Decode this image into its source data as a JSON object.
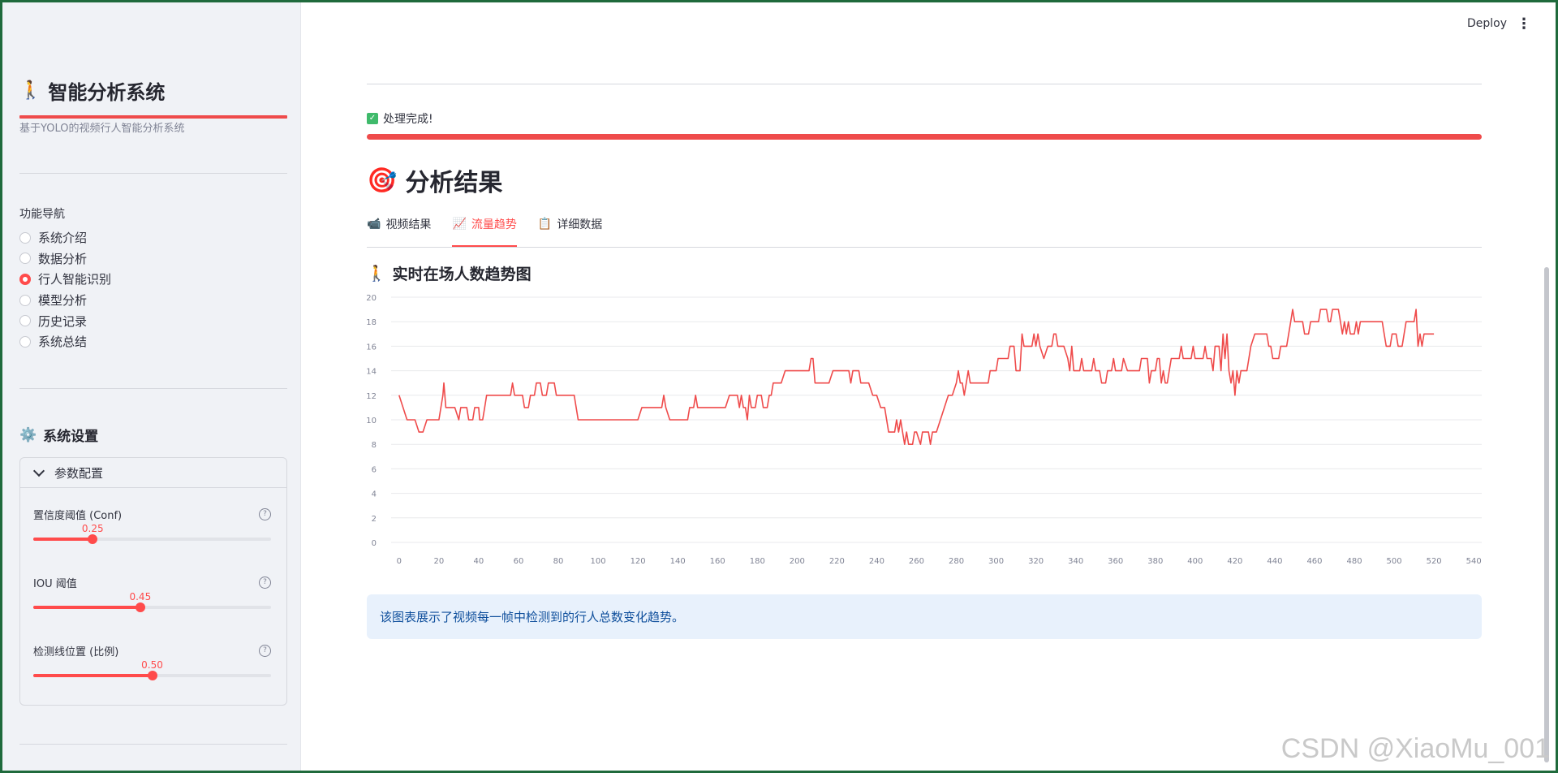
{
  "sidebar": {
    "title_emoji": "🚶",
    "title": "智能分析系统",
    "subtitle": "基于YOLO的视频行人智能分析系统",
    "nav_label": "功能导航",
    "nav_items": [
      "系统介绍",
      "数据分析",
      "行人智能识别",
      "模型分析",
      "历史记录",
      "系统总结"
    ],
    "nav_selected": "行人智能识别",
    "settings_emoji": "⚙️",
    "settings_title": "系统设置",
    "expander_label": "参数配置",
    "sliders": [
      {
        "label": "置信度阈值 (Conf)",
        "value_text": "0.25",
        "fraction": 0.25
      },
      {
        "label": "IOU 阈值",
        "value_text": "0.45",
        "fraction": 0.45
      },
      {
        "label": "检测线位置 (比例)",
        "value_text": "0.50",
        "fraction": 0.5
      }
    ]
  },
  "header": {
    "deploy_label": "Deploy",
    "menu_icon": "⋮"
  },
  "main": {
    "status_text": "处理完成!",
    "progress": 1.0,
    "section_emoji": "🎯",
    "section_title": "分析结果",
    "tabs": [
      {
        "icon": "📹",
        "label": "视频结果"
      },
      {
        "icon": "📈",
        "label": "流量趋势"
      },
      {
        "icon": "📋",
        "label": "详细数据"
      }
    ],
    "active_tab": "流量趋势",
    "chart_emoji": "🚶",
    "chart_title": "实时在场人数趋势图",
    "info_text": "该图表展示了视频每一帧中检测到的行人总数变化趋势。"
  },
  "watermark": "CSDN @XiaoMu_001",
  "colors": {
    "accent": "#ff4b4b",
    "line": "#ef4b4b",
    "info_bg": "#e8f1fc",
    "info_text": "#0f4f9c"
  },
  "chart_data": {
    "type": "line",
    "title": "实时在场人数趋势图",
    "xlabel": "",
    "ylabel": "",
    "xlim": [
      -4,
      544
    ],
    "ylim": [
      0,
      20
    ],
    "xticks": [
      0,
      20,
      40,
      60,
      80,
      100,
      120,
      140,
      160,
      180,
      200,
      220,
      240,
      260,
      280,
      300,
      320,
      340,
      360,
      380,
      400,
      420,
      440,
      460,
      480,
      500,
      520,
      540
    ],
    "yticks": [
      0,
      2,
      4,
      6,
      8,
      10,
      12,
      14,
      16,
      18,
      20
    ],
    "grid": true,
    "series": [
      {
        "values": [
          [
            0,
            12
          ],
          [
            2,
            11
          ],
          [
            4,
            10
          ],
          [
            8,
            10
          ],
          [
            10,
            9
          ],
          [
            12,
            9
          ],
          [
            14,
            10
          ],
          [
            20,
            10
          ],
          [
            22,
            12
          ],
          [
            22.5,
            13
          ],
          [
            23,
            12
          ],
          [
            23.5,
            11
          ],
          [
            28,
            11
          ],
          [
            30,
            10
          ],
          [
            31,
            11
          ],
          [
            34,
            11
          ],
          [
            35,
            10
          ],
          [
            37,
            10
          ],
          [
            38,
            11
          ],
          [
            40,
            11
          ],
          [
            40.5,
            10
          ],
          [
            42,
            10
          ],
          [
            43,
            11
          ],
          [
            44,
            12
          ],
          [
            56,
            12
          ],
          [
            57,
            13
          ],
          [
            58,
            12
          ],
          [
            62,
            12
          ],
          [
            63,
            11
          ],
          [
            65,
            11
          ],
          [
            66,
            12
          ],
          [
            68,
            12
          ],
          [
            69,
            13
          ],
          [
            71,
            13
          ],
          [
            72,
            12
          ],
          [
            74,
            12
          ],
          [
            75,
            13
          ],
          [
            78,
            13
          ],
          [
            79,
            12
          ],
          [
            88,
            12
          ],
          [
            90,
            10
          ],
          [
            120,
            10
          ],
          [
            122,
            11
          ],
          [
            132,
            11
          ],
          [
            133,
            12
          ],
          [
            134,
            11
          ],
          [
            136,
            10
          ],
          [
            145,
            10
          ],
          [
            146,
            11
          ],
          [
            148,
            11
          ],
          [
            149,
            12
          ],
          [
            150,
            11
          ],
          [
            164,
            11
          ],
          [
            166,
            12
          ],
          [
            170,
            12
          ],
          [
            171,
            11
          ],
          [
            172,
            12
          ],
          [
            173,
            11
          ],
          [
            174,
            11
          ],
          [
            175,
            10
          ],
          [
            176,
            12
          ],
          [
            177,
            11
          ],
          [
            179,
            11
          ],
          [
            180,
            12
          ],
          [
            182,
            12
          ],
          [
            183,
            11
          ],
          [
            185,
            11
          ],
          [
            186,
            12
          ],
          [
            187,
            12
          ],
          [
            188,
            13
          ],
          [
            192,
            13
          ],
          [
            194,
            14
          ],
          [
            206,
            14
          ],
          [
            207,
            15
          ],
          [
            208,
            15
          ],
          [
            209,
            13
          ],
          [
            216,
            13
          ],
          [
            218,
            14
          ],
          [
            226,
            14
          ],
          [
            227,
            13
          ],
          [
            228,
            14
          ],
          [
            231,
            14
          ],
          [
            232,
            13
          ],
          [
            236,
            13
          ],
          [
            238,
            12
          ],
          [
            240,
            12
          ],
          [
            242,
            11
          ],
          [
            244,
            11
          ],
          [
            246,
            9
          ],
          [
            249,
            9
          ],
          [
            250,
            10
          ],
          [
            251,
            9
          ],
          [
            252,
            10
          ],
          [
            253,
            9
          ],
          [
            254,
            8
          ],
          [
            255,
            9
          ],
          [
            256,
            8
          ],
          [
            258,
            8
          ],
          [
            259,
            9
          ],
          [
            260,
            9
          ],
          [
            262,
            8
          ],
          [
            263,
            9
          ],
          [
            266,
            9
          ],
          [
            267,
            8
          ],
          [
            268,
            9
          ],
          [
            270,
            9
          ],
          [
            272,
            10
          ],
          [
            274,
            11
          ],
          [
            276,
            12
          ],
          [
            278,
            12
          ],
          [
            280,
            13
          ],
          [
            281,
            14
          ],
          [
            282,
            13
          ],
          [
            283,
            13
          ],
          [
            284,
            12
          ],
          [
            285,
            13
          ],
          [
            286,
            14
          ],
          [
            287,
            13
          ],
          [
            296,
            13
          ],
          [
            297,
            14
          ],
          [
            300,
            14
          ],
          [
            301,
            15
          ],
          [
            306,
            15
          ],
          [
            307,
            16
          ],
          [
            309,
            16
          ],
          [
            310,
            14
          ],
          [
            312,
            14
          ],
          [
            313,
            17
          ],
          [
            314,
            16
          ],
          [
            318,
            16
          ],
          [
            319,
            17
          ],
          [
            320,
            16
          ],
          [
            321,
            17
          ],
          [
            322,
            16
          ],
          [
            324,
            15
          ],
          [
            326,
            16
          ],
          [
            328,
            16
          ],
          [
            329,
            17
          ],
          [
            330,
            17
          ],
          [
            331,
            16
          ],
          [
            334,
            16
          ],
          [
            336,
            15
          ],
          [
            337,
            14
          ],
          [
            338,
            16
          ],
          [
            339,
            14
          ],
          [
            342,
            14
          ],
          [
            343,
            15
          ],
          [
            344,
            14
          ],
          [
            348,
            14
          ],
          [
            349,
            15
          ],
          [
            350,
            14
          ],
          [
            352,
            14
          ],
          [
            353,
            13
          ],
          [
            355,
            13
          ],
          [
            356,
            14
          ],
          [
            358,
            14
          ],
          [
            359,
            15
          ],
          [
            360,
            14
          ],
          [
            363,
            14
          ],
          [
            364,
            15
          ],
          [
            366,
            14
          ],
          [
            372,
            14
          ],
          [
            373,
            15
          ],
          [
            376,
            15
          ],
          [
            377,
            13
          ],
          [
            378,
            14
          ],
          [
            380,
            14
          ],
          [
            381,
            15
          ],
          [
            382,
            15
          ],
          [
            383,
            13
          ],
          [
            384,
            14
          ],
          [
            385,
            13
          ],
          [
            386,
            13
          ],
          [
            387,
            14
          ],
          [
            388,
            15
          ],
          [
            392,
            15
          ],
          [
            393,
            16
          ],
          [
            394,
            15
          ],
          [
            398,
            15
          ],
          [
            399,
            16
          ],
          [
            400,
            15
          ],
          [
            404,
            15
          ],
          [
            405,
            16
          ],
          [
            406,
            15
          ],
          [
            408,
            15
          ],
          [
            409,
            14
          ],
          [
            410,
            16
          ],
          [
            412,
            16
          ],
          [
            413,
            14
          ],
          [
            414,
            17
          ],
          [
            415,
            15
          ],
          [
            416,
            17
          ],
          [
            417,
            14
          ],
          [
            418,
            13
          ],
          [
            419,
            14
          ],
          [
            420,
            12
          ],
          [
            421,
            14
          ],
          [
            422,
            13
          ],
          [
            423,
            14
          ],
          [
            426,
            14
          ],
          [
            428,
            16
          ],
          [
            430,
            17
          ],
          [
            436,
            17
          ],
          [
            437,
            16
          ],
          [
            438,
            16
          ],
          [
            439,
            15
          ],
          [
            442,
            15
          ],
          [
            443,
            16
          ],
          [
            446,
            16
          ],
          [
            448,
            18
          ],
          [
            449,
            19
          ],
          [
            450,
            18
          ],
          [
            454,
            18
          ],
          [
            455,
            17
          ],
          [
            457,
            17
          ],
          [
            458,
            18
          ],
          [
            462,
            18
          ],
          [
            463,
            19
          ],
          [
            466,
            19
          ],
          [
            467,
            18
          ],
          [
            468,
            18
          ],
          [
            469,
            19
          ],
          [
            472,
            19
          ],
          [
            473,
            18
          ],
          [
            474,
            17
          ],
          [
            475,
            18
          ],
          [
            476,
            17
          ],
          [
            477,
            18
          ],
          [
            478,
            17
          ],
          [
            480,
            17
          ],
          [
            481,
            18
          ],
          [
            482,
            17
          ],
          [
            483,
            18
          ],
          [
            494,
            18
          ],
          [
            495,
            17
          ],
          [
            496,
            16
          ],
          [
            498,
            16
          ],
          [
            499,
            17
          ],
          [
            501,
            17
          ],
          [
            502,
            16
          ],
          [
            504,
            16
          ],
          [
            506,
            18
          ],
          [
            510,
            18
          ],
          [
            511,
            19
          ],
          [
            512,
            16
          ],
          [
            513,
            17
          ],
          [
            514,
            16
          ],
          [
            515,
            17
          ],
          [
            520,
            17
          ]
        ]
      }
    ]
  }
}
